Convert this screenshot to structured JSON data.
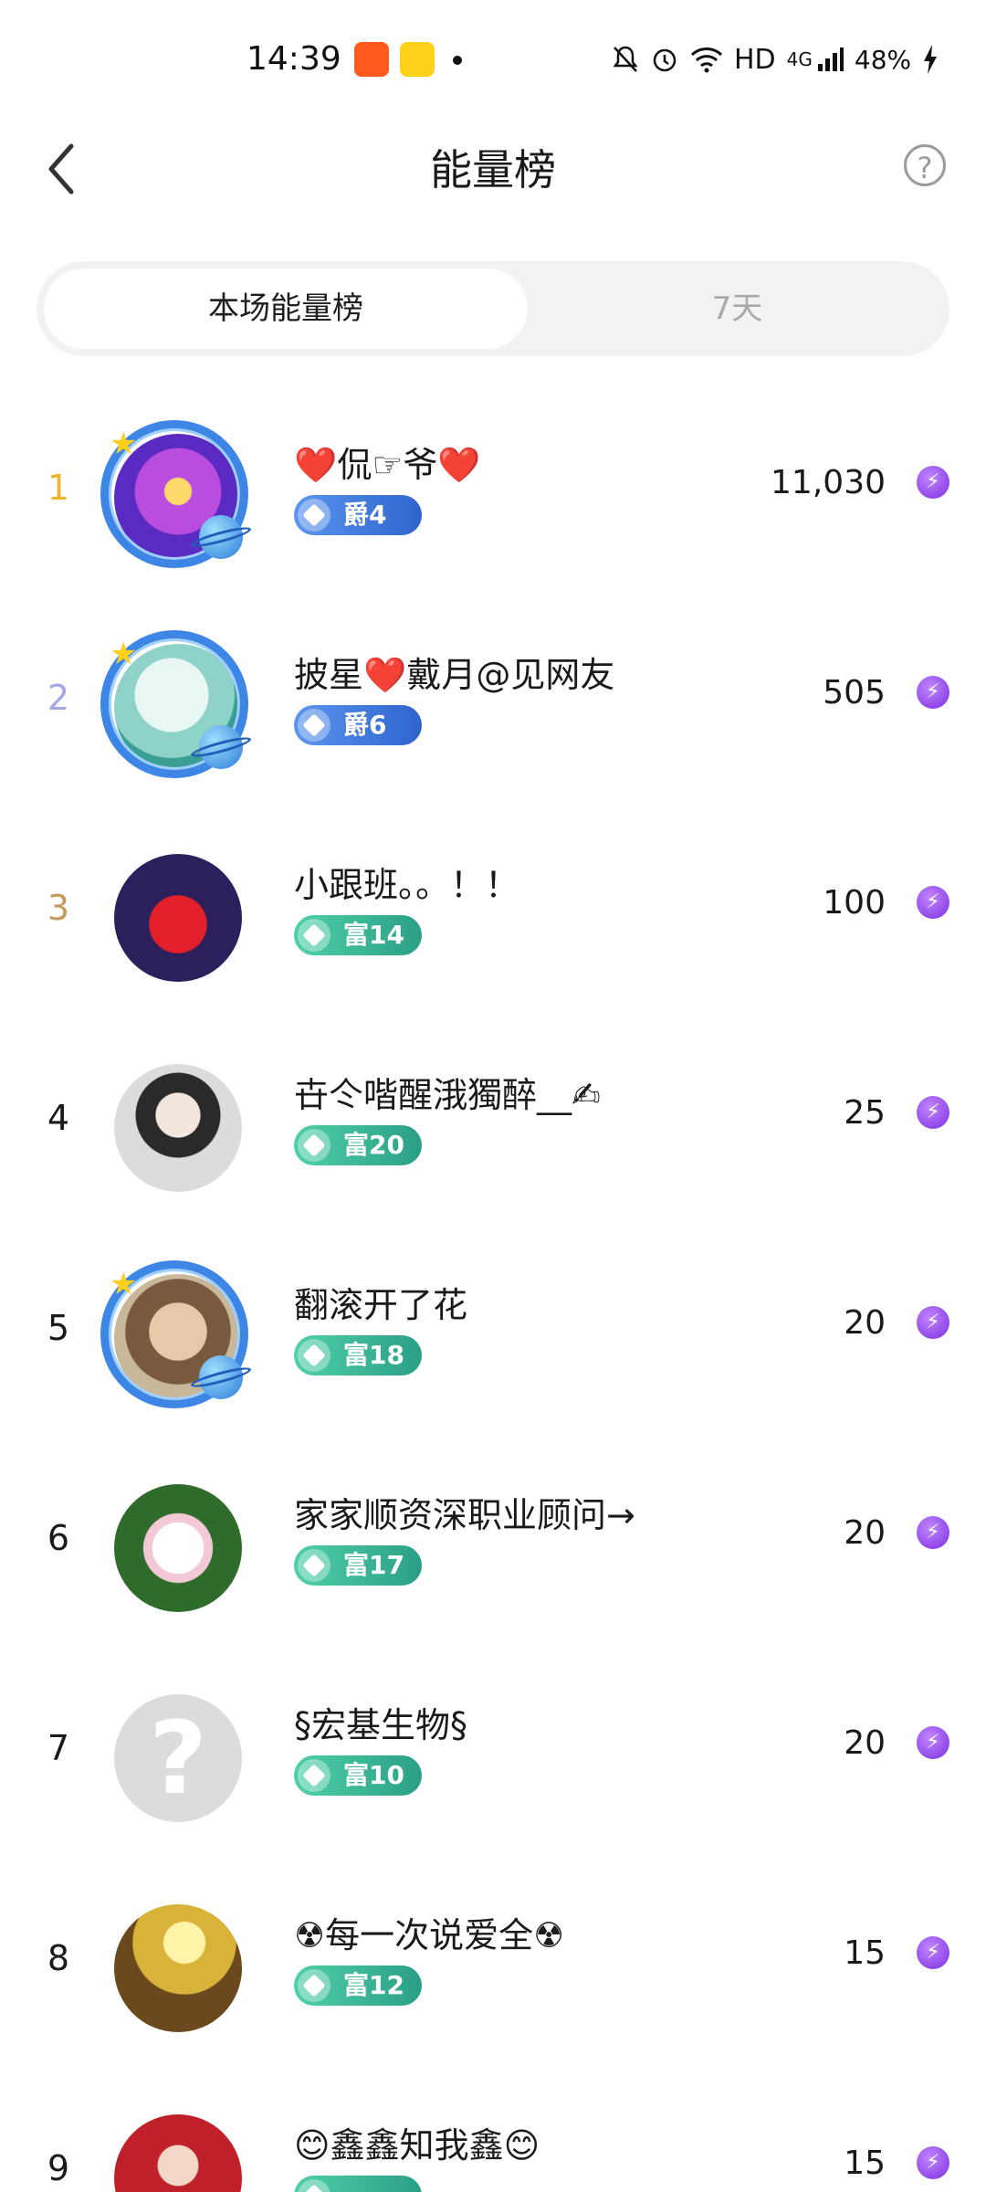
{
  "status_bar": {
    "time": "14:39",
    "hd": "HD",
    "net": "4G",
    "battery": "48%"
  },
  "header": {
    "title": "能量榜",
    "help_label": "?"
  },
  "tabs": [
    {
      "label": "本场能量榜",
      "active": true
    },
    {
      "label": "7天",
      "active": false
    }
  ],
  "colors": {
    "rank1": "#f0b429",
    "rank2": "#a3a8e8",
    "rank3": "#c59a5c",
    "jue_badge": "#3f78e0",
    "fu_badge": "#35b393",
    "energy_icon": "#8a3ff0"
  },
  "rows": [
    {
      "rank": "1",
      "name": "❤️侃☞爷❤️",
      "badge": "爵4",
      "badge_type": "jue",
      "score": "11,030"
    },
    {
      "rank": "2",
      "name": "披星❤️戴月@见网友",
      "badge": "爵6",
      "badge_type": "jue",
      "score": "505"
    },
    {
      "rank": "3",
      "name": "小跟班。。！！",
      "badge": "富14",
      "badge_type": "fu",
      "score": "100"
    },
    {
      "rank": "4",
      "name": "卋仒喈醒涐獨醉__✍",
      "badge": "富20",
      "badge_type": "fu",
      "score": "25"
    },
    {
      "rank": "5",
      "name": "翻滚开了花",
      "badge": "富18",
      "badge_type": "fu",
      "score": "20"
    },
    {
      "rank": "6",
      "name": "家家顺资深职业顾问→",
      "badge": "富17",
      "badge_type": "fu",
      "score": "20"
    },
    {
      "rank": "7",
      "name": "§宏基生物§",
      "badge": "富10",
      "badge_type": "fu",
      "score": "20"
    },
    {
      "rank": "8",
      "name": "☢每一次说爱全☢",
      "badge": "富12",
      "badge_type": "fu",
      "score": "15"
    },
    {
      "rank": "9",
      "name": "😊鑫鑫知我鑫😊",
      "badge": "",
      "badge_type": "fu",
      "score": "15"
    }
  ]
}
